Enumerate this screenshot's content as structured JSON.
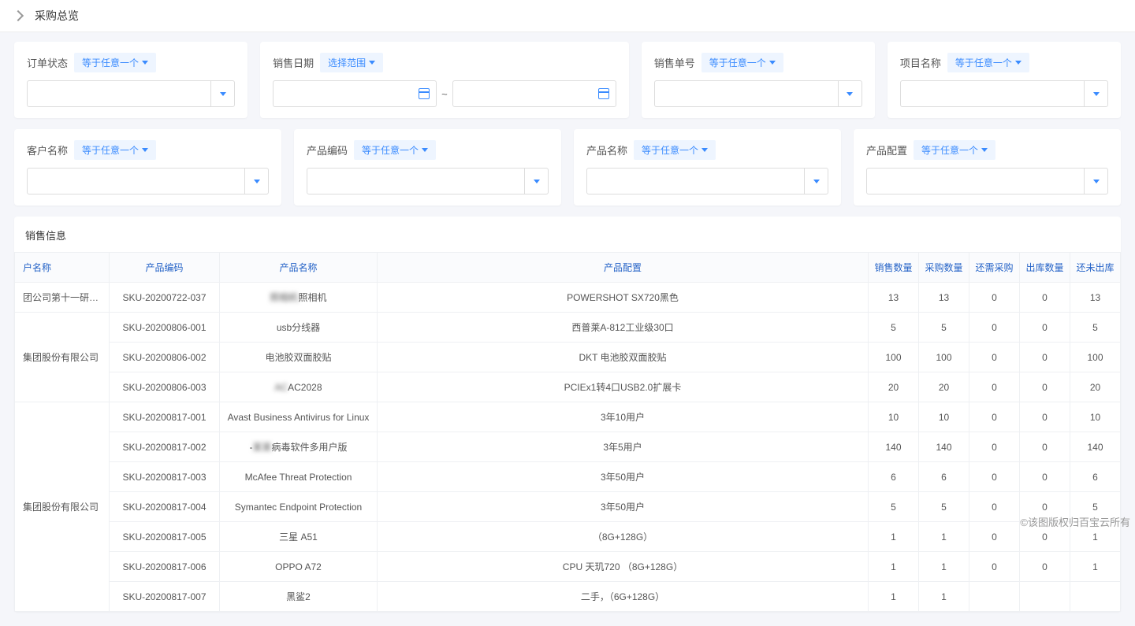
{
  "header": {
    "title": "采购总览"
  },
  "filters": {
    "op_any": "等于任意一个",
    "op_range": "选择范围",
    "order_status": "订单状态",
    "sales_date": "销售日期",
    "sales_no": "销售单号",
    "project_name": "项目名称",
    "customer_name": "客户名称",
    "product_code": "产品编码",
    "product_name": "产品名称",
    "product_config": "产品配置",
    "range_sep": "~"
  },
  "section": {
    "title": "销售信息"
  },
  "table": {
    "headers": {
      "customer": "户名称",
      "sku": "产品编码",
      "name": "产品名称",
      "config": "产品配置",
      "sales_qty": "销售数量",
      "purchase_qty": "采购数量",
      "need_purchase": "还需采购",
      "out_qty": "出库数量",
      "not_out": "还未出库"
    },
    "groups": [
      {
        "customer": "团公司第十一研究所",
        "rows": [
          {
            "sku": "SKU-20200722-037",
            "name_prefix": "",
            "name_blur": "照相机",
            "name_suffix": "照相机",
            "config": "POWERSHOT SX720黑色",
            "nums": [
              13,
              13,
              0,
              0,
              13
            ]
          }
        ]
      },
      {
        "customer": "集团股份有限公司",
        "rows": [
          {
            "sku": "SKU-20200806-001",
            "name": "usb分线器",
            "config": "西普莱A-812工业级30口",
            "nums": [
              5,
              5,
              0,
              0,
              5
            ]
          },
          {
            "sku": "SKU-20200806-002",
            "name": "电池胶双面胶贴",
            "config": "DKT 电池胶双面胶贴",
            "nums": [
              100,
              100,
              0,
              0,
              100
            ]
          },
          {
            "sku": "SKU-20200806-003",
            "name_prefix": "",
            "name_blur": "AC",
            "name_suffix": "AC2028",
            "config": "PCIEx1转4口USB2.0扩展卡",
            "nums": [
              20,
              20,
              0,
              0,
              20
            ]
          }
        ]
      },
      {
        "customer": "集团股份有限公司",
        "rows": [
          {
            "sku": "SKU-20200817-001",
            "name": "Avast Business Antivirus for Linux",
            "config": "3年10用户",
            "nums": [
              10,
              10,
              0,
              0,
              10
            ]
          },
          {
            "sku": "SKU-20200817-002",
            "name_prefix": "-",
            "name_blur": "某某",
            "name_suffix": "病毒软件多用户版",
            "config": "3年5用户",
            "nums": [
              140,
              140,
              0,
              0,
              140
            ]
          },
          {
            "sku": "SKU-20200817-003",
            "name": "McAfee Threat Protection",
            "config": "3年50用户",
            "nums": [
              6,
              6,
              0,
              0,
              6
            ]
          },
          {
            "sku": "SKU-20200817-004",
            "name": "Symantec Endpoint Protection",
            "config": "3年50用户",
            "nums": [
              5,
              5,
              0,
              0,
              5
            ]
          },
          {
            "sku": "SKU-20200817-005",
            "name": "三星 A51",
            "config": "（8G+128G）",
            "nums": [
              1,
              1,
              0,
              0,
              1
            ]
          },
          {
            "sku": "SKU-20200817-006",
            "name": "OPPO A72",
            "config": "CPU 天玑720 （8G+128G）",
            "nums": [
              1,
              1,
              0,
              0,
              1
            ]
          },
          {
            "sku": "SKU-20200817-007",
            "name": "黑鲨2",
            "config": "二手，（6G+128G）",
            "nums": [
              1,
              1,
              null,
              null,
              null
            ]
          }
        ]
      }
    ]
  },
  "watermark": "©该图版权归百宝云所有"
}
